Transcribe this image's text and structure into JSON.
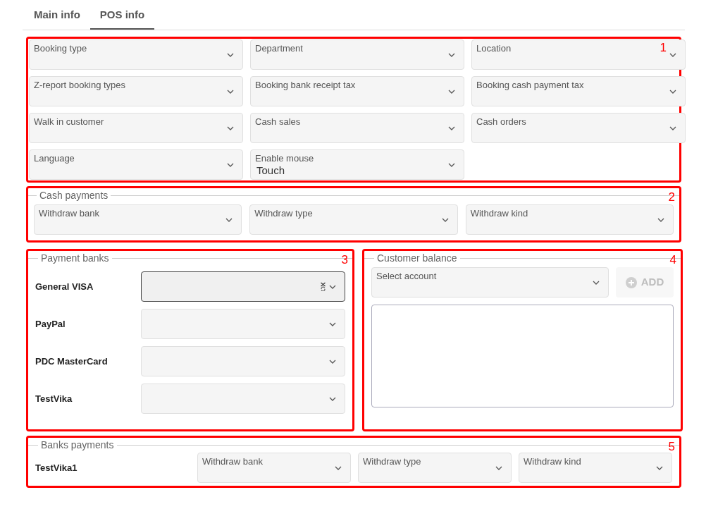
{
  "tabs": [
    {
      "label": "Main info",
      "selected": false
    },
    {
      "label": "POS info",
      "selected": true
    }
  ],
  "general": {
    "marker": "1",
    "fields": [
      {
        "label": "Booking type"
      },
      {
        "label": "Department"
      },
      {
        "label": "Location"
      },
      {
        "label": "Z-report booking types"
      },
      {
        "label": "Booking bank receipt tax"
      },
      {
        "label": "Booking cash payment tax"
      },
      {
        "label": "Walk in customer"
      },
      {
        "label": "Cash sales"
      },
      {
        "label": "Cash orders"
      },
      {
        "label": "Language"
      },
      {
        "label": "Enable mouse",
        "value": "Touch"
      }
    ]
  },
  "cash_payments": {
    "marker": "2",
    "legend": "Cash payments",
    "fields": [
      {
        "label": "Withdraw bank"
      },
      {
        "label": "Withdraw type"
      },
      {
        "label": "Withdraw kind"
      }
    ]
  },
  "payment_banks": {
    "marker": "3",
    "legend": "Payment banks",
    "rows": [
      {
        "name": "General VISA",
        "focused": true
      },
      {
        "name": "PayPal",
        "focused": false
      },
      {
        "name": "PDC MasterCard",
        "focused": false
      },
      {
        "name": "TestVika",
        "focused": false
      }
    ]
  },
  "customer_balance": {
    "marker": "4",
    "legend": "Customer balance",
    "select": {
      "label": "Select account"
    },
    "add_button": {
      "label": "ADD",
      "disabled": true
    }
  },
  "banks_payments": {
    "marker": "5",
    "legend": "Banks payments",
    "rows": [
      {
        "name": "TestVika1",
        "fields": [
          {
            "label": "Withdraw bank"
          },
          {
            "label": "Withdraw type"
          },
          {
            "label": "Withdraw kind"
          }
        ]
      }
    ]
  }
}
